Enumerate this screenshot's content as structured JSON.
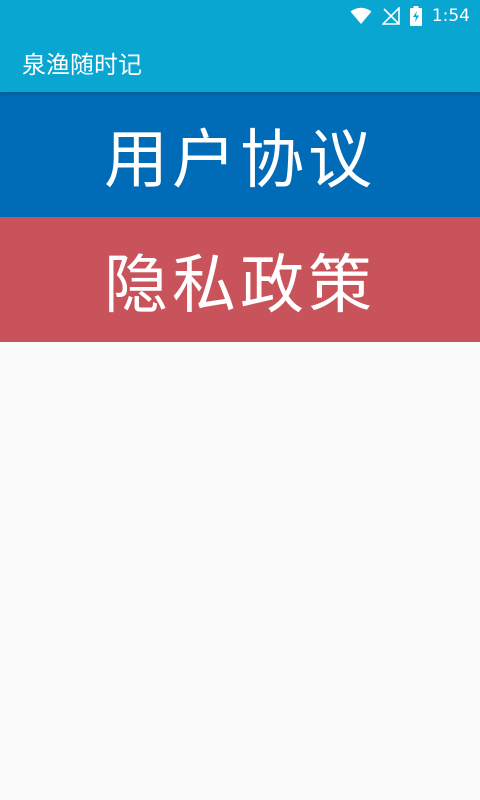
{
  "status_bar": {
    "time": "1:54",
    "icons": [
      "wifi-icon",
      "no-signal-icon",
      "battery-charging-icon"
    ]
  },
  "app_bar": {
    "title": "泉渔随时记"
  },
  "menu": {
    "user_agreement": "用户协议",
    "privacy_policy": "隐私政策"
  },
  "colors": {
    "status_bar": "#0aa6d2",
    "app_bar": "#0aa6d2",
    "user_agreement_bg": "#006bb6",
    "privacy_policy_bg": "#c8535b",
    "background": "#fafafa"
  }
}
